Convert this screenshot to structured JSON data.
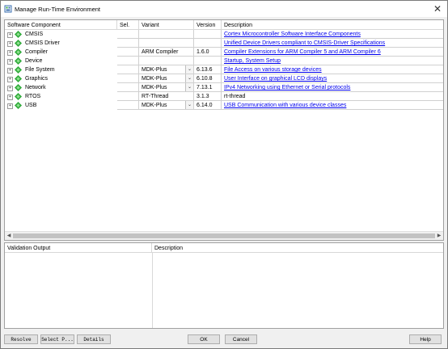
{
  "window": {
    "title": "Manage Run-Time Environment",
    "close_glyph": "✕"
  },
  "columns": {
    "software_component": "Software Component",
    "sel": "Sel.",
    "variant": "Variant",
    "version": "Version",
    "description": "Description"
  },
  "rows": [
    {
      "name": "CMSIS",
      "variant": "",
      "version": "",
      "description": "Cortex Microcontroller Software Interface Components",
      "link": true,
      "dropdown": false
    },
    {
      "name": "CMSIS Driver",
      "variant": "",
      "version": "",
      "description": "Unified Device Drivers compliant to CMSIS-Driver Specifications",
      "link": true,
      "dropdown": false
    },
    {
      "name": "Compiler",
      "variant": "ARM Compiler",
      "version": "1.6.0",
      "description": "Compiler Extensions for ARM Compiler 5 and ARM Compiler 6",
      "link": true,
      "dropdown": false
    },
    {
      "name": "Device",
      "variant": "",
      "version": "",
      "description": "Startup, System Setup",
      "link": true,
      "dropdown": false
    },
    {
      "name": "File System",
      "variant": "MDK-Plus",
      "version": "6.13.6",
      "description": "File Access on various storage devices",
      "link": true,
      "dropdown": true
    },
    {
      "name": "Graphics",
      "variant": "MDK-Plus",
      "version": "6.10.8",
      "description": "User Interface on graphical LCD displays",
      "link": true,
      "dropdown": true
    },
    {
      "name": "Network",
      "variant": "MDK-Plus",
      "version": "7.13.1",
      "description": "IPv4 Networking using Ethernet or Serial protocols",
      "link": true,
      "dropdown": true
    },
    {
      "name": "RTOS",
      "variant": "RT-Thread",
      "version": "3.1.3",
      "description": "rt-thread",
      "link": false,
      "dropdown": false
    },
    {
      "name": "USB",
      "variant": "MDK-Plus",
      "version": "6.14.0",
      "description": "USB Communication with various device classes",
      "link": true,
      "dropdown": true
    }
  ],
  "validation": {
    "output_header": "Validation Output",
    "description_header": "Description"
  },
  "buttons": {
    "resolve": "Resolve",
    "select_packs": "Select P...",
    "details": "Details",
    "ok": "OK",
    "cancel": "Cancel",
    "help": "Help"
  },
  "icons": {
    "expander": "+",
    "dropdown": "⌄",
    "scroll_left": "◀",
    "scroll_right": "▶"
  },
  "colors": {
    "gem": "#2eaa3a",
    "link": "#0000ee"
  }
}
